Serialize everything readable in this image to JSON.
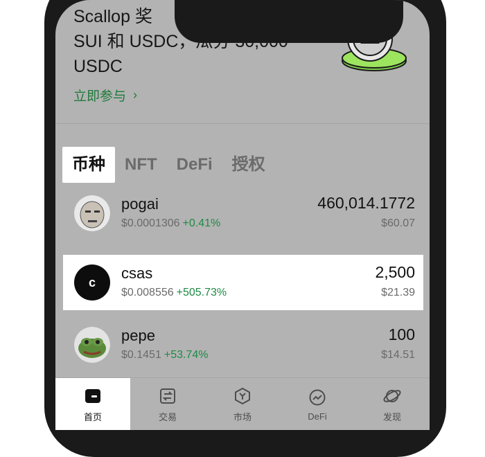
{
  "promo": {
    "line1": "Scallop 奖",
    "line2": "SUI 和 USDC，瓜分 30,000",
    "line3": "USDC",
    "link_label": "立即参与"
  },
  "tabs": [
    {
      "label": "币种",
      "active": true
    },
    {
      "label": "NFT",
      "active": false
    },
    {
      "label": "DeFi",
      "active": false
    },
    {
      "label": "授权",
      "active": false
    }
  ],
  "tokens": [
    {
      "symbol": "pogai",
      "price": "$0.0001306",
      "change": "+0.41%",
      "amount": "460,014.1772",
      "value": "$60.07",
      "icon": "pogai-avatar-icon"
    },
    {
      "symbol": "csas",
      "price": "$0.008556",
      "change": "+505.73%",
      "amount": "2,500",
      "value": "$21.39",
      "icon": "csas-letter-icon",
      "avatar_letter": "c"
    },
    {
      "symbol": "pepe",
      "price": "$0.1451",
      "change": "+53.74%",
      "amount": "100",
      "value": "$14.51",
      "icon": "pepe-frog-icon"
    }
  ],
  "bottom_nav": [
    {
      "label": "首页",
      "icon": "wallet-icon",
      "active": true
    },
    {
      "label": "交易",
      "icon": "swap-icon",
      "active": false
    },
    {
      "label": "市场",
      "icon": "market-icon",
      "active": false
    },
    {
      "label": "DeFi",
      "icon": "defi-icon",
      "active": false
    },
    {
      "label": "发现",
      "icon": "discover-icon",
      "active": false
    }
  ],
  "colors": {
    "screen_bg": "#b3b3b3",
    "positive": "#1f8a45",
    "link": "#1f7a3a",
    "frame": "#1a1a1a"
  }
}
